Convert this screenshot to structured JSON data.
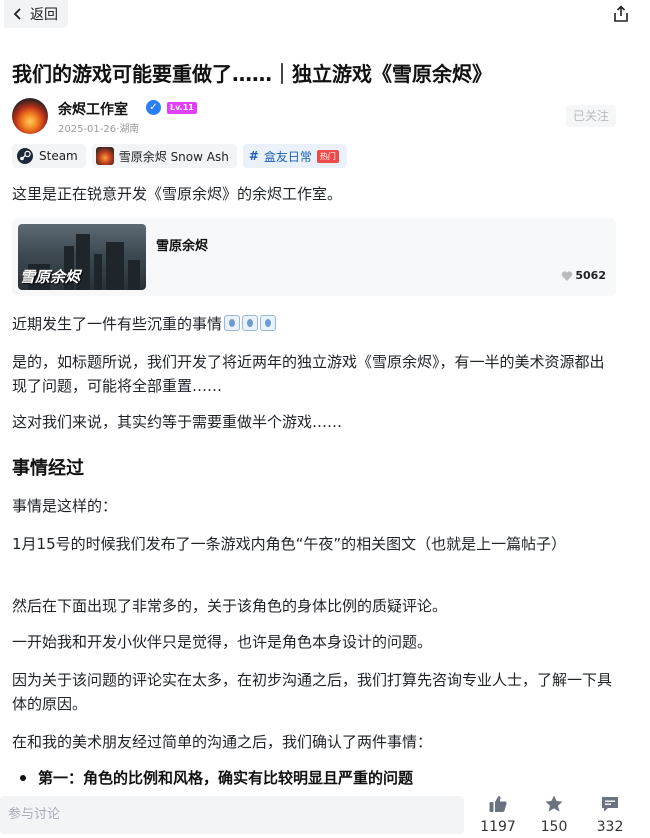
{
  "topbar": {
    "back_label": "返回"
  },
  "post": {
    "title": "我们的游戏可能要重做了……｜独立游戏《雪原余烬》",
    "author": {
      "name": "余烬工作室",
      "level": "Lv.11",
      "date": "2025-01-26",
      "location": "湖南",
      "follow_label": "已关注"
    },
    "tags": [
      {
        "label": "Steam",
        "icon": "steam-icon"
      },
      {
        "label": "雪原余烬 Snow Ash",
        "icon": "game-icon"
      },
      {
        "label": "盒友日常",
        "badge": "热门",
        "icon": "hash-icon"
      }
    ],
    "intro": "这里是正在锐意开发《雪原余烬》的余烬工作室。",
    "game_card": {
      "name": "雪原余烬",
      "thumb_text": "雪原余烬",
      "likes": "5062"
    },
    "paragraphs": [
      "近期发生了一件有些沉重的事情",
      "是的，如标题所说，我们开发了将近两年的独立游戏《雪原余烬》，有一半的美术资源都出现了问题，可能将全部重置……",
      "这对我们来说，其实约等于需要重做半个游戏……"
    ],
    "section_heading": "事情经过",
    "section_paragraphs": [
      "事情是这样的：",
      "1月15号的时候我们发布了一条游戏内角色“午夜”的相关图文（也就是上一篇帖子）",
      "然后在下面出现了非常多的，关于该角色的身体比例的质疑评论。",
      "一开始我和开发小伙伴只是觉得，也许是角色本身设计的问题。",
      "因为关于该问题的评论实在太多，在初步沟通之后，我们打算先咨询专业人士，了解一下具体的原因。",
      "在和我的美术朋友经过简单的沟通之后，我们确认了两件事情："
    ],
    "bullet": "第一：角色的比例和风格，确实有比较明显且严重的问题"
  },
  "bottombar": {
    "comment_placeholder": "参与讨论",
    "likes": "1197",
    "favorites": "150",
    "comments": "332"
  },
  "colors": {
    "accent": "#2a7ff5",
    "hot": "#ef4a4a",
    "level": "#e040fb"
  }
}
